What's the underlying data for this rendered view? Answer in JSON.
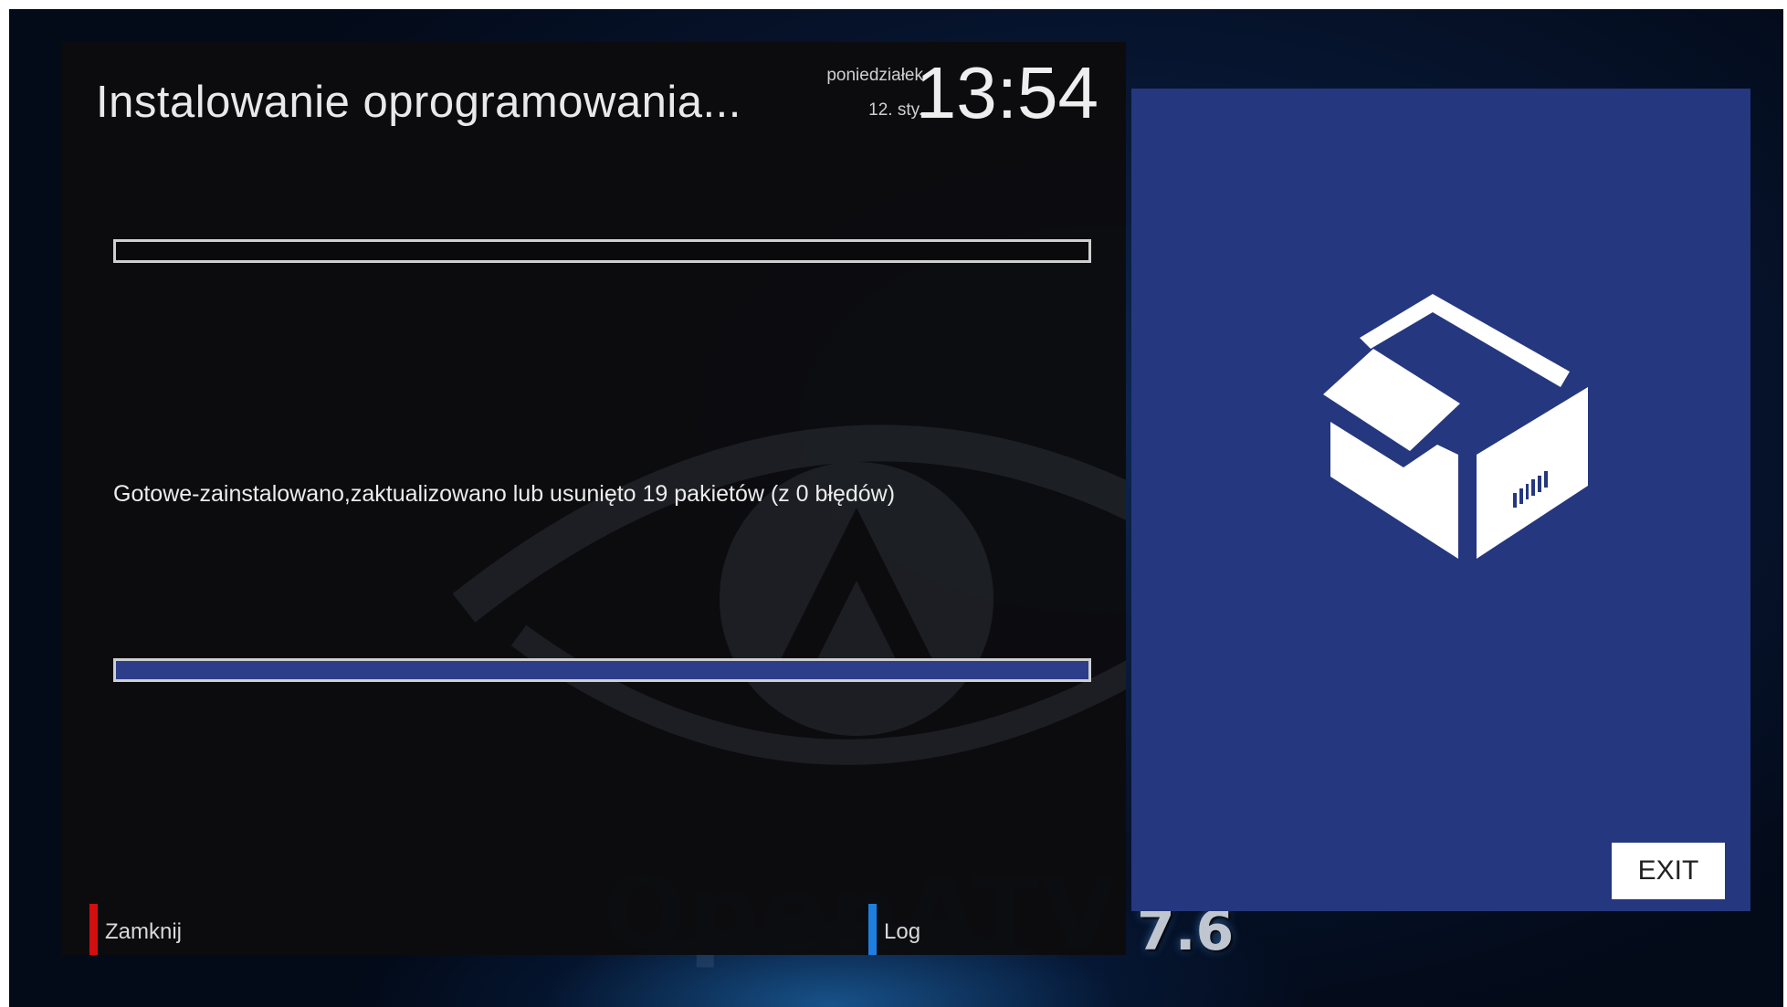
{
  "header": {
    "title": "Instalowanie oprogramowania...",
    "weekday": "poniedziałek",
    "date": "12. sty.",
    "time": "13:54"
  },
  "progress": {
    "top_fraction": 0.0,
    "bottom_fraction": 1.0
  },
  "status": {
    "message": "Gotowe-zainstalowano,zaktualizowano lub usunięto 19 pakietów (z 0 błędów)"
  },
  "buttons": {
    "red_label": "Zamknij",
    "blue_label": "Log",
    "exit_label": "EXIT"
  },
  "brand": {
    "name": "OpenATV",
    "version": "7.6"
  },
  "colors": {
    "red_key": "#d20f0f",
    "blue_key": "#1f7fe0",
    "panel_blue": "#24377f",
    "progress_fill": "#2c3e8a"
  },
  "icons": {
    "info_panel_icon": "package-box-icon"
  }
}
